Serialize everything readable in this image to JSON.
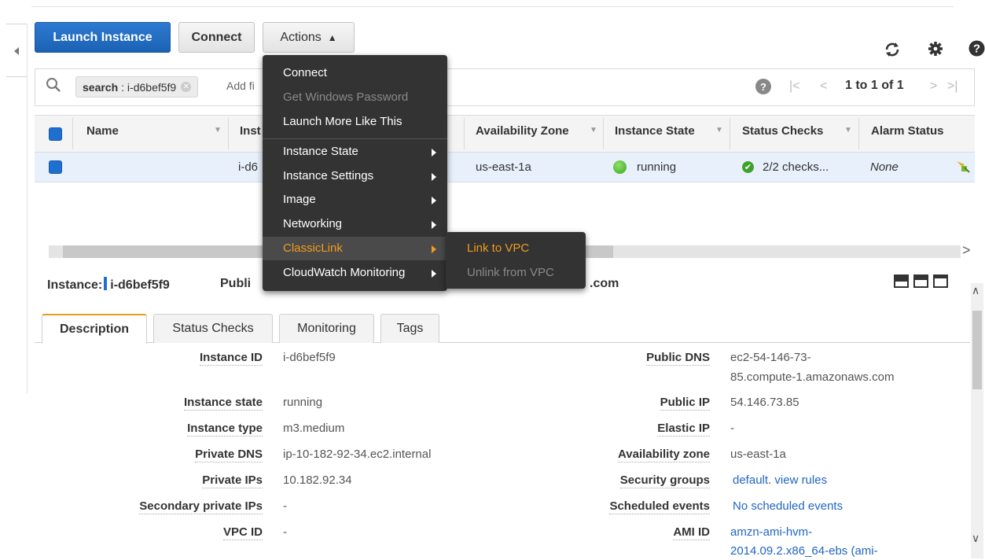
{
  "toolbar": {
    "launch_label": "Launch Instance",
    "connect_label": "Connect",
    "actions_label": "Actions",
    "icons": [
      "refresh-icon",
      "gear-icon",
      "help-icon"
    ]
  },
  "search": {
    "token_key": "search",
    "token_value": ": i-d6bef5f9",
    "add_filter": "Add fi",
    "pager_text": "1 to 1 of 1"
  },
  "table": {
    "columns": [
      "Name",
      "Inst",
      "Availability Zone",
      "Instance State",
      "Status Checks",
      "Alarm Status"
    ],
    "row": {
      "instance_id": "i-d6",
      "availability_zone": "us-east-1a",
      "instance_state": "running",
      "status_checks": "2/2 checks...",
      "alarm_status": "None"
    }
  },
  "actions_menu": {
    "items": [
      {
        "label": "Connect",
        "disabled": false
      },
      {
        "label": "Get Windows Password",
        "disabled": true
      },
      {
        "label": "Launch More Like This",
        "disabled": false
      },
      {
        "label": "Instance State",
        "submenu": true
      },
      {
        "label": "Instance Settings",
        "submenu": true
      },
      {
        "label": "Image",
        "submenu": true
      },
      {
        "label": "Networking",
        "submenu": true
      },
      {
        "label": "ClassicLink",
        "submenu": true,
        "highlighted": true
      },
      {
        "label": "CloudWatch Monitoring",
        "submenu": true
      }
    ],
    "classiclink_submenu": [
      {
        "label": "Link to VPC",
        "disabled": false
      },
      {
        "label": "Unlink from VPC",
        "disabled": true
      }
    ]
  },
  "detail_header": {
    "instance_label": "Instance:",
    "instance_id": "i-d6bef5f9",
    "public_prefix": "Publi",
    "suffix": ".com"
  },
  "tabs": [
    "Description",
    "Status Checks",
    "Monitoring",
    "Tags"
  ],
  "description": {
    "left": [
      {
        "label": "Instance ID",
        "value": "i-d6bef5f9"
      },
      {
        "label": "Instance state",
        "value": "running"
      },
      {
        "label": "Instance type",
        "value": "m3.medium"
      },
      {
        "label": "Private DNS",
        "value": "ip-10-182-92-34.ec2.internal"
      },
      {
        "label": "Private IPs",
        "value": "10.182.92.34"
      },
      {
        "label": "Secondary private IPs",
        "value": "-"
      },
      {
        "label": "VPC ID",
        "value": "-"
      }
    ],
    "right": [
      {
        "label": "Public DNS",
        "value_line1": "ec2-54-146-73-",
        "value_line2": "85.compute-1.amazonaws.com"
      },
      {
        "label": "Public IP",
        "value": "54.146.73.85"
      },
      {
        "label": "Elastic IP",
        "value": "-"
      },
      {
        "label": "Availability zone",
        "value": "us-east-1a"
      },
      {
        "label": "Security groups",
        "value": "default",
        "link2": "view rules"
      },
      {
        "label": "Scheduled events",
        "value": "No scheduled events"
      },
      {
        "label": "AMI ID",
        "value_line1": "amzn-ami-hvm-",
        "value_line2": "2014.09.2.x86_64-ebs (ami-"
      }
    ]
  },
  "colors": {
    "primary_button": "#1f6fd1",
    "menu_bg": "#333333",
    "menu_highlight": "#f29b1c",
    "running_green": "#3aa51f",
    "link": "#2166c2",
    "tab_accent": "#e99b1f"
  }
}
